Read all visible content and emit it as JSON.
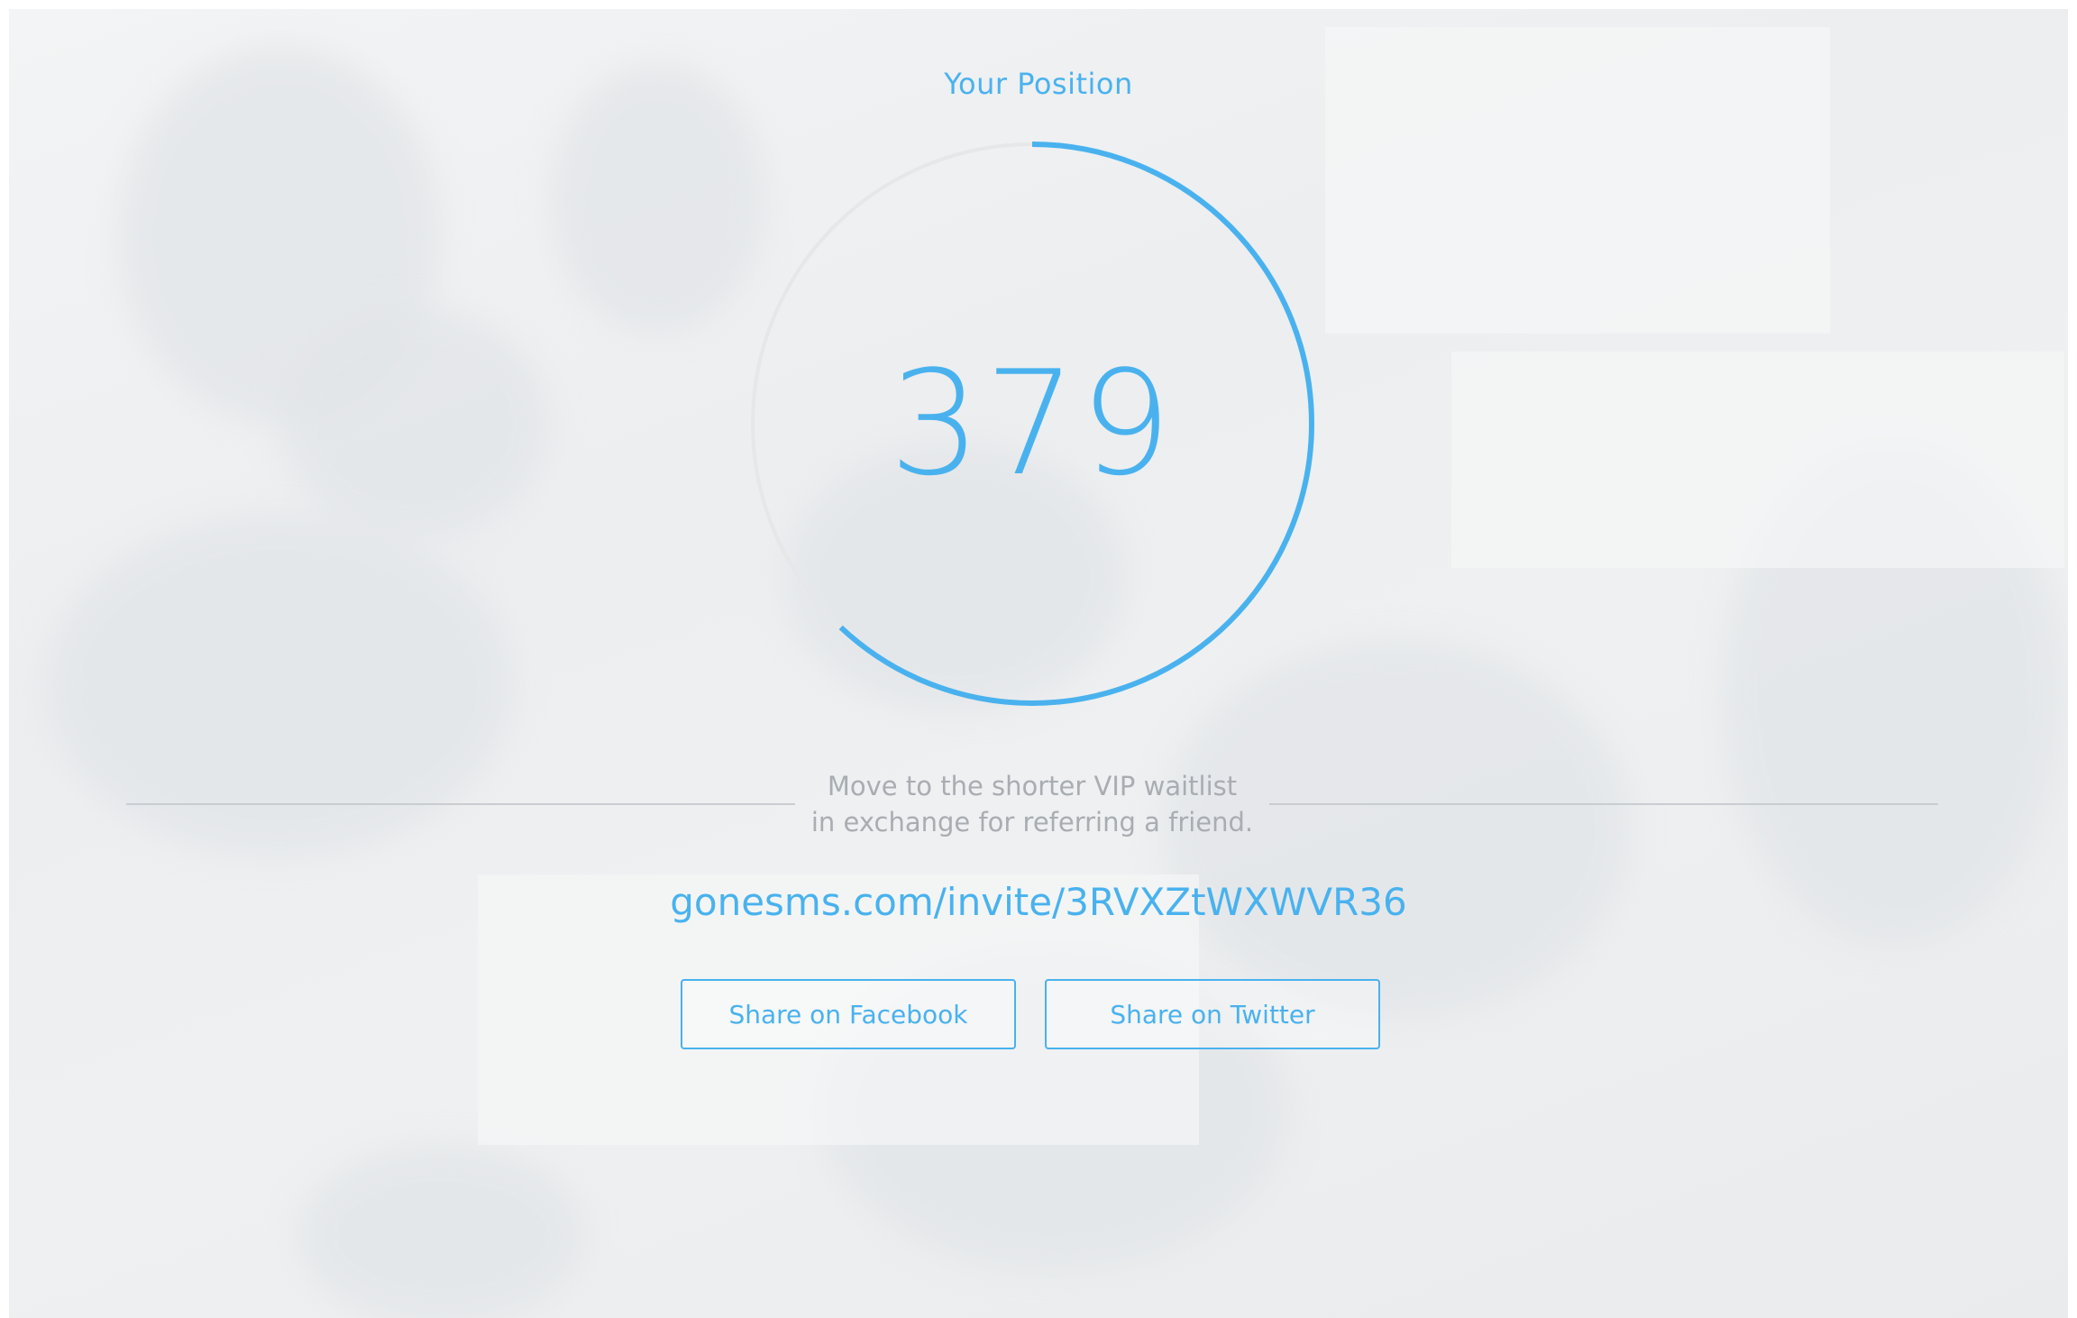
{
  "header": {
    "title": "Your Position"
  },
  "position": {
    "value": "379",
    "progress_fraction": 0.62
  },
  "referral": {
    "description_line1": "Move to the shorter VIP waitlist",
    "description_line2": "in exchange for referring a friend.",
    "invite_link": "gonesms.com/invite/3RVXZtWXWVR36"
  },
  "actions": {
    "facebook_label": "Share on Facebook",
    "twitter_label": "Share on Twitter"
  },
  "colors": {
    "accent": "#49b2ee",
    "track": "#e6e7e8",
    "muted_text": "#a9adb2"
  }
}
